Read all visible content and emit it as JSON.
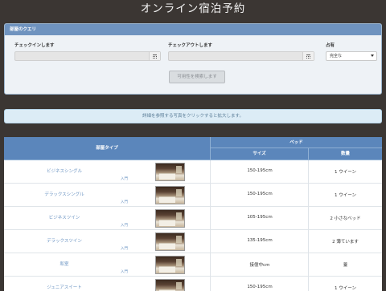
{
  "header": {
    "title": "オンライン宿泊予約"
  },
  "query": {
    "panel_title": "部屋のクエリ",
    "checkin_label": "チェックインします",
    "checkout_label": "チェックアウトします",
    "occupancy_label": "占有",
    "occupancy_value": "完全な",
    "search_button": "可用性を検索します"
  },
  "info": {
    "text": "詳細を参照する写真をクリックすると拡大します。"
  },
  "table": {
    "col_room_type": "部屋タイプ",
    "col_bed": "ベッド",
    "col_size": "サイズ",
    "col_count": "数量",
    "rows": [
      {
        "name": "ビジネスシングル",
        "link": "入門",
        "size": "150-195cm",
        "beds": "1 ウイーン"
      },
      {
        "name": "デラックスシングル",
        "link": "入門",
        "size": "150-195cm",
        "beds": "1 ウイーン"
      },
      {
        "name": "ビジネスツイン",
        "link": "入門",
        "size": "105-195cm",
        "beds": "2 小さなベッド"
      },
      {
        "name": "デラックスツイン",
        "link": "入門",
        "size": "135-195cm",
        "beds": "2 薄ています"
      },
      {
        "name": "和室",
        "link": "入門",
        "size": "接億中cm",
        "beds": "薹"
      },
      {
        "name": "ジュニアスイート",
        "link": "入門",
        "size": "150-195cm",
        "beds": "1 ウイーン"
      }
    ]
  },
  "colors": {
    "background": "#3b3633",
    "panel_header": "#6f93bf",
    "table_header": "#5b86bb",
    "link": "#6a93c2"
  }
}
